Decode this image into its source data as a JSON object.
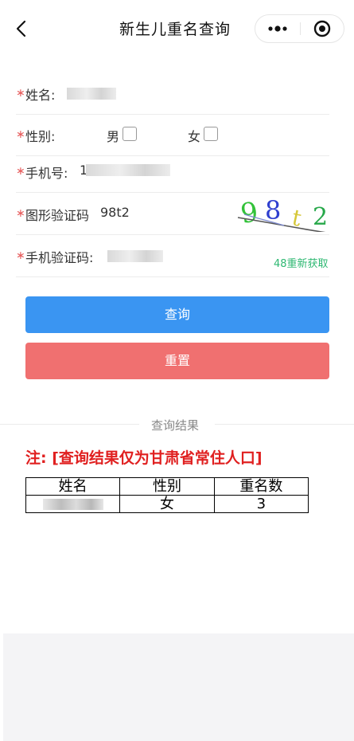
{
  "nav": {
    "title": "新生儿重名查询",
    "back_icon": "chevron-left-icon",
    "more_icon": "more-dots-icon",
    "close_icon": "close-target-icon"
  },
  "form": {
    "name": {
      "label": "姓名:"
    },
    "gender": {
      "label": "性别:",
      "male": "男",
      "female": "女"
    },
    "phone": {
      "label": "手机号:",
      "value_prefix": "1"
    },
    "captcha": {
      "label": "图形验证码",
      "value": "98t2",
      "image_text": [
        "9",
        "8",
        "t",
        "2"
      ]
    },
    "sms": {
      "label": "手机验证码:",
      "resend": "48重新获取"
    }
  },
  "buttons": {
    "query": "查询",
    "reset": "重置"
  },
  "result": {
    "section_title": "查询结果",
    "note": "注: [查询结果仅为甘肃省常住人口]",
    "columns": [
      "姓名",
      "性别",
      "重名数"
    ],
    "rows": [
      {
        "gender": "女",
        "count": "3"
      }
    ]
  },
  "colors": {
    "primary": "#3a95f2",
    "danger": "#f07070",
    "required": "#e65a5a",
    "countdown": "#2eb872",
    "note": "#e02020"
  }
}
